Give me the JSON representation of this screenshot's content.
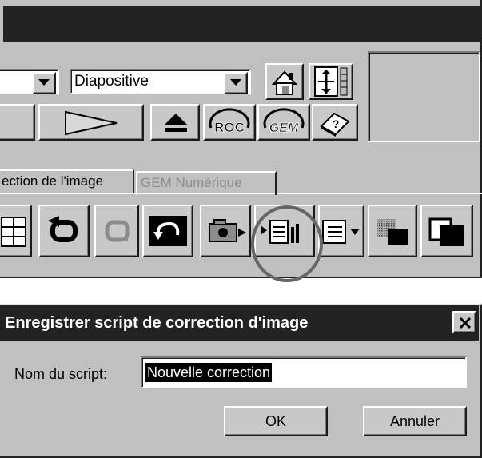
{
  "toolbar": {
    "film_type_value": "Diapositive"
  },
  "tabs": [
    {
      "label": "ection de l'image",
      "active": true
    },
    {
      "label": "GEM Numérique",
      "active": false
    }
  ],
  "icons": {
    "roc_label": "ROC",
    "gem_label": "GEM"
  },
  "dialog": {
    "title": "Enregistrer script de correction d'image",
    "script_name_label": "Nom du script:",
    "script_name_value": "Nouvelle correction",
    "ok_label": "OK",
    "cancel_label": "Annuler"
  },
  "colors": {
    "titlebar": "#222222",
    "panel": "#c0c0c0",
    "highlight": "#666666"
  }
}
